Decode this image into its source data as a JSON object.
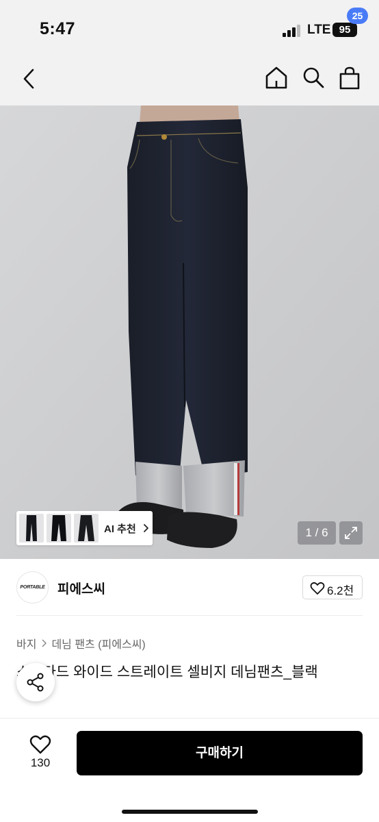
{
  "status_bar": {
    "time": "5:47",
    "network": "LTE",
    "battery": "95"
  },
  "nav": {
    "back_icon": "chevron-left-icon",
    "home_icon": "home-icon",
    "search_icon": "search-icon",
    "cart_icon": "shopping-bag-icon",
    "cart_badge": "25",
    "badge_color": "#4a7bf7"
  },
  "gallery": {
    "ai_recommend_label": "AI 추천",
    "page_indicator": "1 / 6",
    "expand_icon": "expand-icon"
  },
  "brand": {
    "logo_text": "PORTABLE",
    "name": "피에스씨",
    "like_count": "6.2천"
  },
  "breadcrumb": {
    "items": [
      "바지",
      "데님 팬츠 (피에스씨)"
    ]
  },
  "product": {
    "title": "스탠다드 와이드 스트레이트 셀비지 데님팬츠_블랙"
  },
  "bottom_bar": {
    "wish_count": "130",
    "buy_label": "구매하기",
    "buy_color": "#000000"
  }
}
